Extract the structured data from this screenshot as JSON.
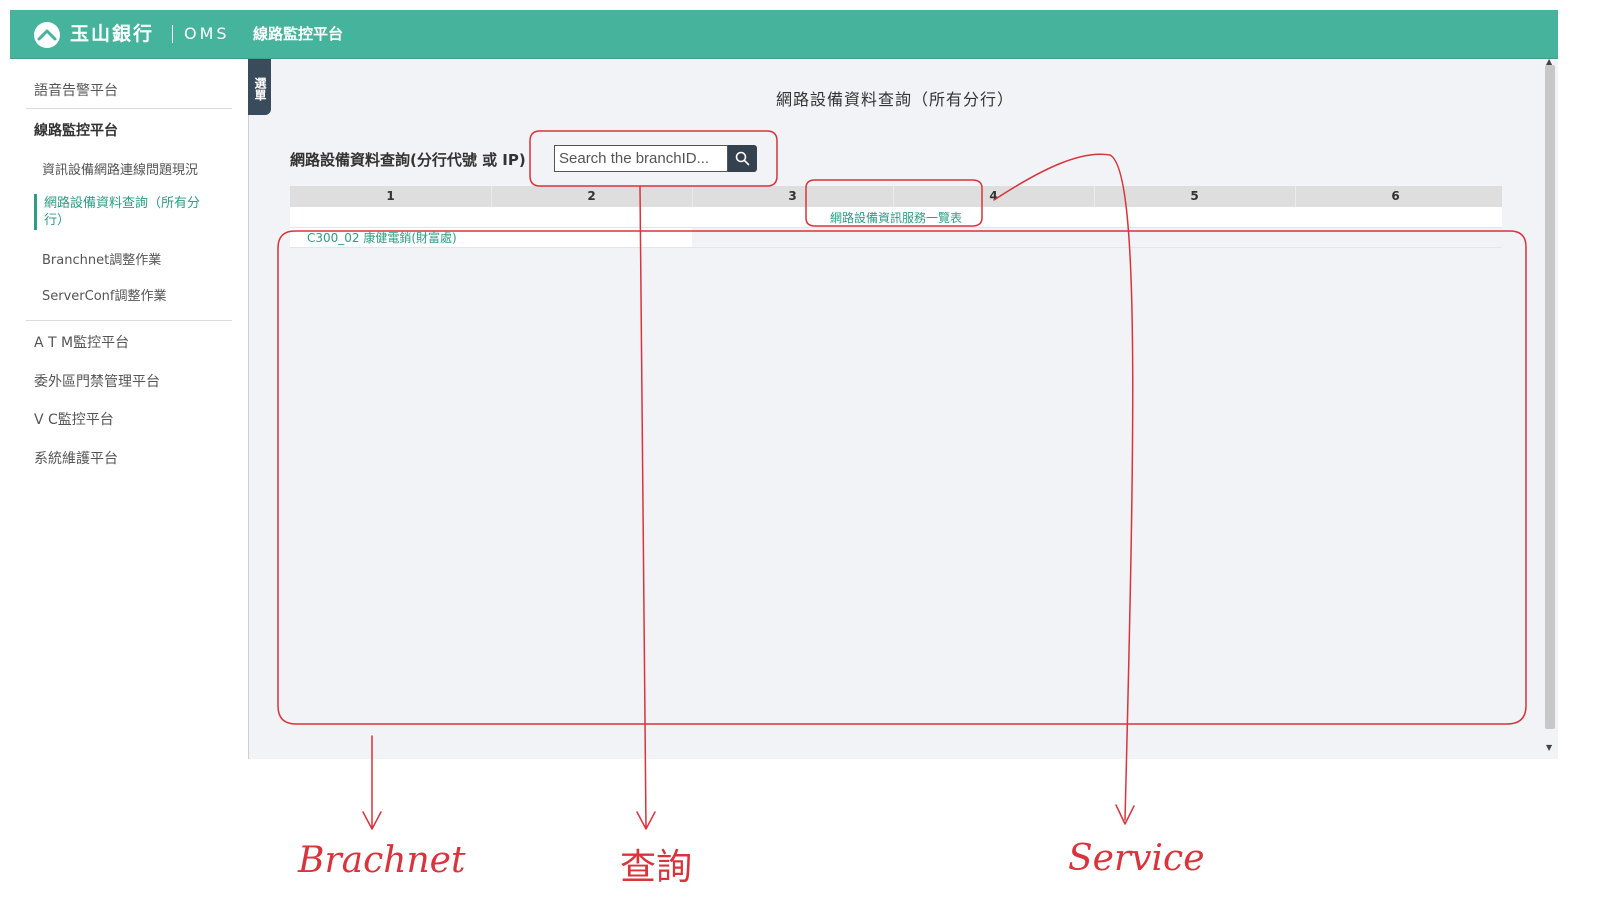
{
  "header": {
    "brand": "玉山銀行",
    "system": "OMS",
    "platform": "線路監控平台",
    "colors": {
      "bar": "#46b49c"
    }
  },
  "sidebar": {
    "items": [
      {
        "label": "語音告警平台"
      },
      {
        "label": "線路監控平台"
      },
      {
        "label": "資訊設備網路連線問題現況"
      },
      {
        "label": "網路設備資料查詢（所有分行）"
      },
      {
        "label": "Branchnet調整作業"
      },
      {
        "label": "ServerConf調整作業"
      },
      {
        "label": "A T M監控平台"
      },
      {
        "label": "委外區門禁管理平台"
      },
      {
        "label": "V C監控平台"
      },
      {
        "label": "系統維護平台"
      }
    ],
    "menu_tab": "選單",
    "accent": "#2e9c86"
  },
  "main": {
    "title": "網路設備資料查詢（所有分行）",
    "search": {
      "label": "網路設備資料查詢(分行代號 或 IP)",
      "placeholder": "Search the branchID...",
      "button_icon": "search-icon"
    },
    "grid": {
      "columns": [
        "1",
        "2",
        "3",
        "4",
        "5",
        "6"
      ],
      "service_link": "網路設備資訊服務一覽表",
      "branch_link": "C300_02 康健電銷(財富處)"
    }
  },
  "annotations": {
    "labels": [
      "Brachnet",
      "查詢",
      "Service"
    ],
    "color": "#d9333c"
  }
}
